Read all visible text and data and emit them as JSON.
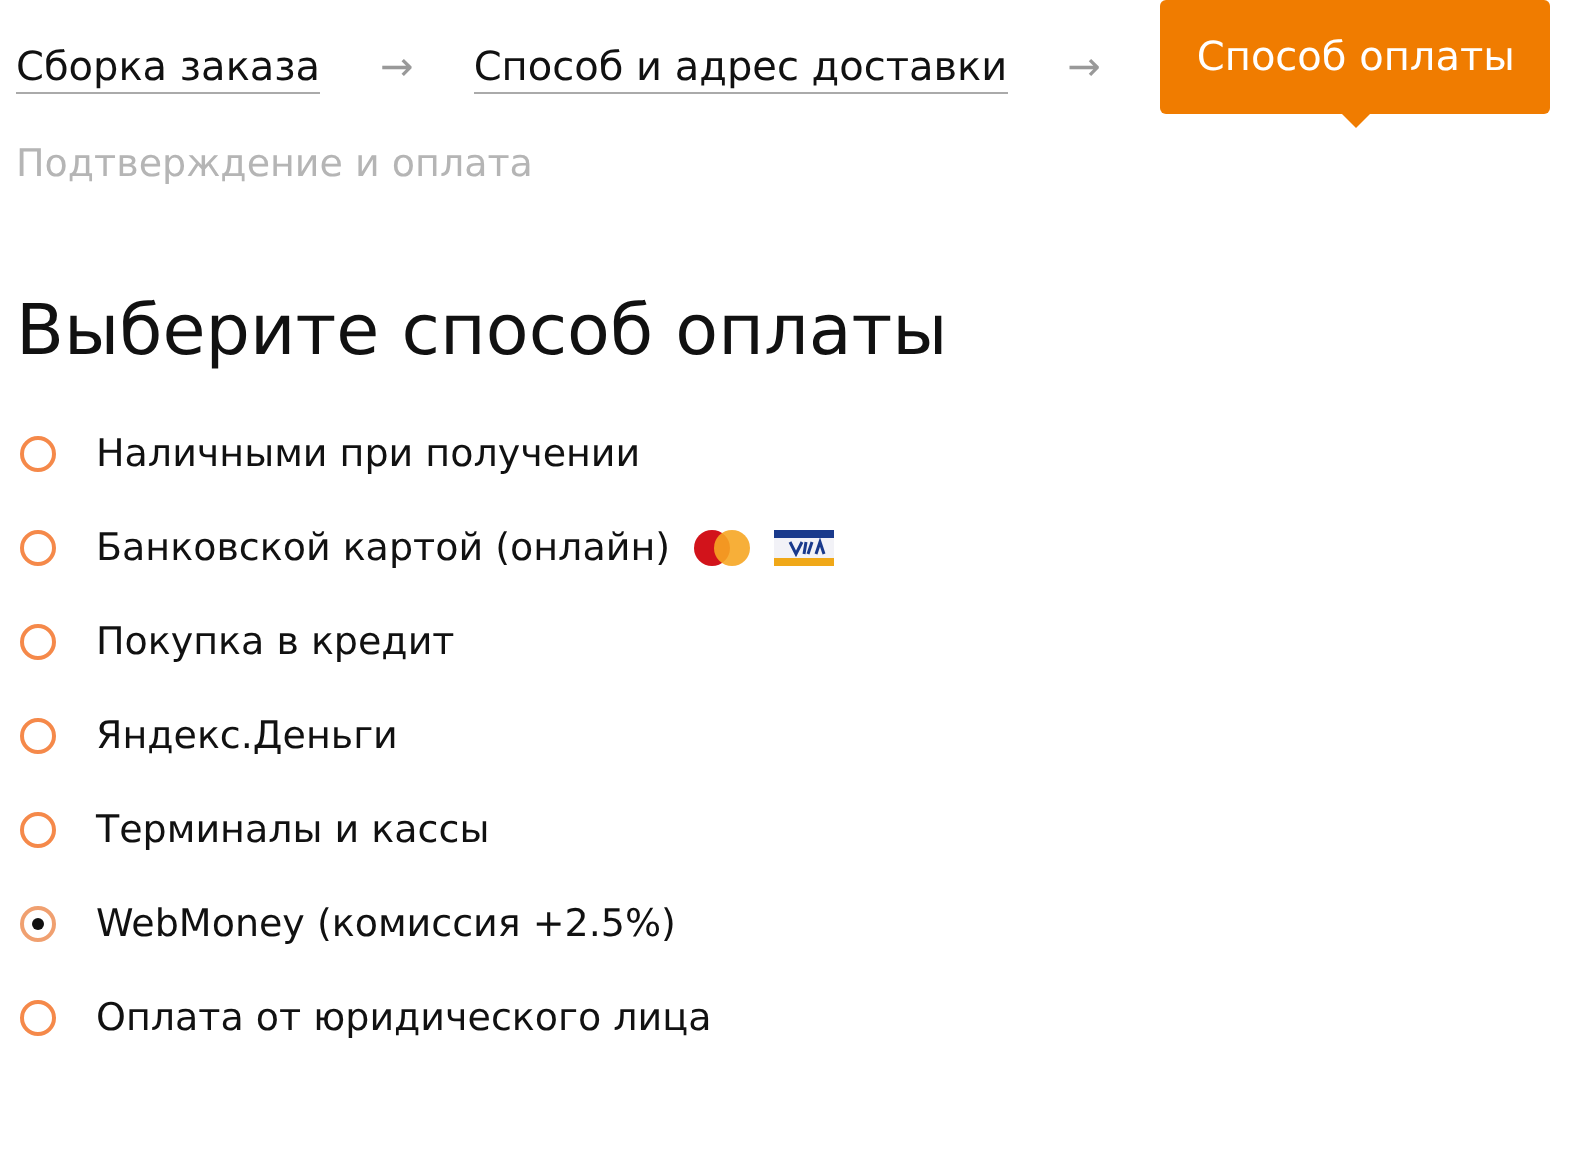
{
  "steps": [
    {
      "kind": "done",
      "label": "Сборка заказа"
    },
    {
      "kind": "arrow",
      "label": "→"
    },
    {
      "kind": "done",
      "label": "Способ и адрес доставки"
    },
    {
      "kind": "arrow",
      "label": "→"
    },
    {
      "kind": "current",
      "label": "Способ оплаты"
    },
    {
      "kind": "upcoming",
      "label": "Подтверждение и оплата"
    }
  ],
  "heading": "Выберите способ оплаты",
  "options": [
    {
      "label": "Наличными при получении",
      "selected": false
    },
    {
      "label": "Банковской картой (онлайн)",
      "selected": false,
      "card_logos": true
    },
    {
      "label": "Покупка в кредит",
      "selected": false
    },
    {
      "label": "Яндекс.Деньги",
      "selected": false
    },
    {
      "label": "Терминалы и кассы",
      "selected": false
    },
    {
      "label": "WebMoney (комиссия +2.5%)",
      "selected": true
    },
    {
      "label": "Оплата от юридического лица",
      "selected": false
    }
  ]
}
